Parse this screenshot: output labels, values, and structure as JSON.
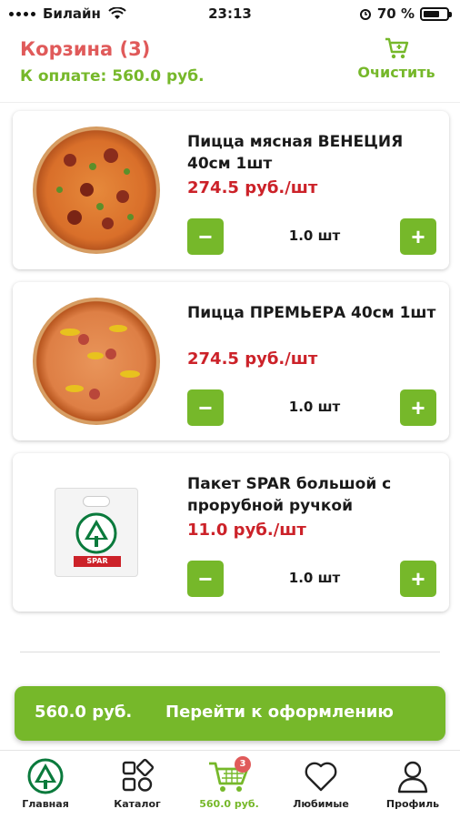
{
  "status_bar": {
    "carrier": "Билайн",
    "time": "23:13",
    "battery": "70 %",
    "battery_level": 0.7
  },
  "header": {
    "title": "Корзина (3)",
    "pay_label": "К оплате:",
    "pay_amount": "560.0 руб.",
    "clear_label": "Очистить",
    "clear_icon": "cart-icon"
  },
  "items": [
    {
      "name": "Пицца мясная ВЕНЕЦИЯ 40см 1шт",
      "price": "274.5 руб./шт",
      "quantity": "1.0 шт",
      "image": "pizza"
    },
    {
      "name": "Пицца ПРЕМЬЕРА 40см 1шт",
      "price": "274.5 руб./шт",
      "quantity": "1.0 шт",
      "image": "pizza"
    },
    {
      "name": "Пакет SPAR большой с прорубной ручкой",
      "price": "11.0 руб./шт",
      "quantity": "1.0 шт",
      "image": "bag",
      "image_label": "SPAR"
    }
  ],
  "quantity_controls": {
    "minus": "−",
    "plus": "+"
  },
  "checkout": {
    "total": "560.0 руб.",
    "action": "Перейти к оформлению"
  },
  "tabbar": {
    "tabs": [
      {
        "label": "Главная",
        "icon": "spar-logo-icon"
      },
      {
        "label": "Каталог",
        "icon": "catalog-icon"
      },
      {
        "label": "560.0 руб.",
        "icon": "cart-icon",
        "badge": "3",
        "active": true
      },
      {
        "label": "Любимые",
        "icon": "heart-icon"
      },
      {
        "label": "Профиль",
        "icon": "profile-icon"
      }
    ]
  },
  "colors": {
    "accent_green": "#76b82a",
    "title_red": "#e05a5a",
    "price_red": "#cc2229"
  }
}
